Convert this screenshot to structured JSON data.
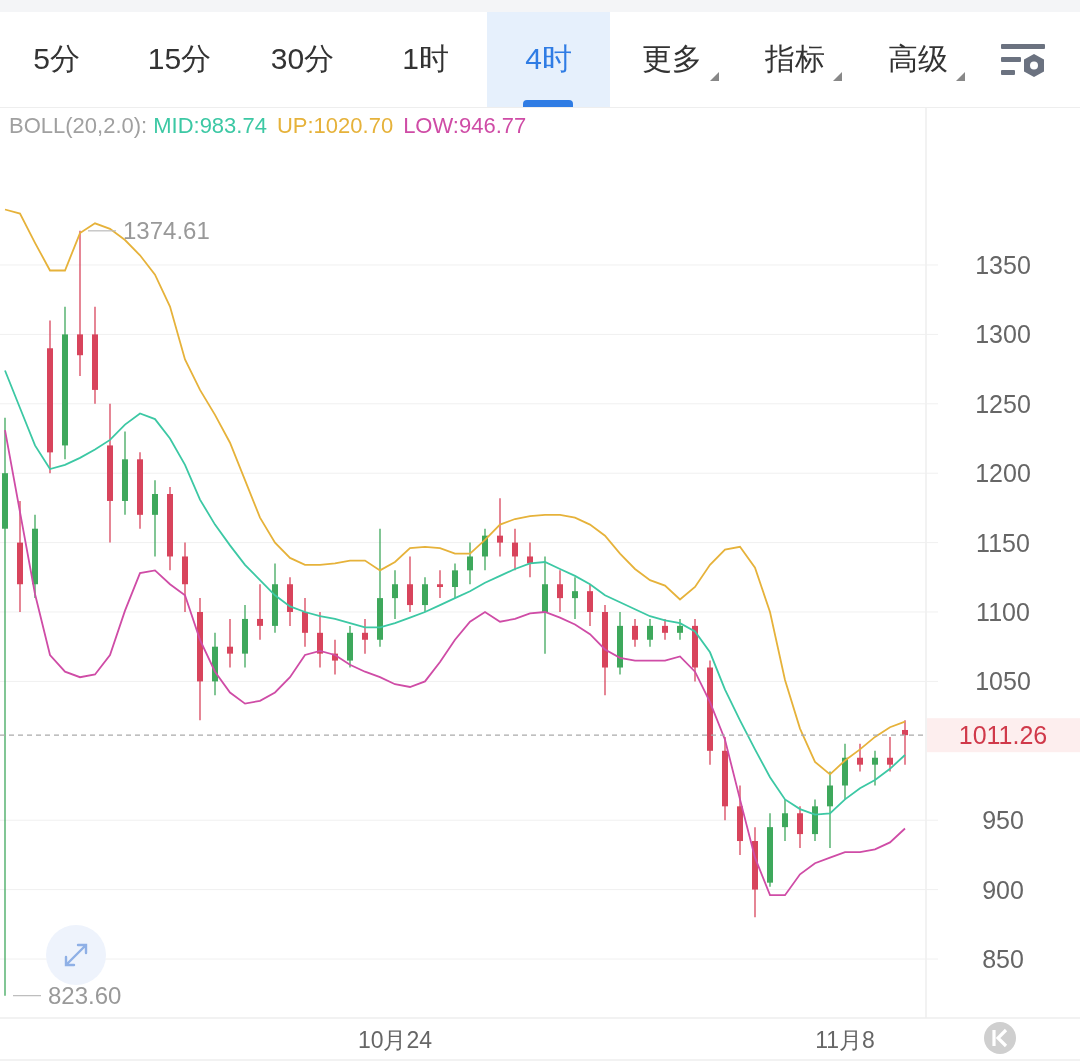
{
  "tabs": [
    {
      "label": "5分",
      "selected": false,
      "kind": "plain"
    },
    {
      "label": "15分",
      "selected": false,
      "kind": "plain"
    },
    {
      "label": "30分",
      "selected": false,
      "kind": "plain"
    },
    {
      "label": "1时",
      "selected": false,
      "kind": "plain"
    },
    {
      "label": "4时",
      "selected": true,
      "kind": "plain"
    },
    {
      "label": "更多",
      "selected": false,
      "kind": "dropdown"
    },
    {
      "label": "指标",
      "selected": false,
      "kind": "dropdown"
    },
    {
      "label": "高级",
      "selected": false,
      "kind": "dropdown"
    }
  ],
  "legend": {
    "label": "BOLL(20,2.0):"
  },
  "chart": {
    "chart_data": {
      "type": "candlestick",
      "categories": [
        null,
        null,
        null,
        null,
        null,
        null,
        null,
        null,
        null,
        null,
        null,
        null,
        null,
        null,
        null,
        null,
        null,
        null,
        null,
        null,
        null,
        null,
        null,
        null,
        null,
        null,
        "10月24",
        null,
        null,
        null,
        null,
        null,
        null,
        null,
        null,
        null,
        null,
        null,
        null,
        null,
        null,
        null,
        null,
        null,
        null,
        null,
        null,
        null,
        null,
        null,
        null,
        null,
        null,
        null,
        null,
        null,
        "11月8",
        null,
        null,
        null,
        null
      ],
      "ohlc": [
        [
          1160,
          1240,
          823.6,
          1200
        ],
        [
          1150,
          1180,
          1100,
          1120
        ],
        [
          1120,
          1170,
          1110,
          1160
        ],
        [
          1290,
          1310,
          1200,
          1215
        ],
        [
          1220,
          1320,
          1210,
          1300
        ],
        [
          1300,
          1374.61,
          1270,
          1285
        ],
        [
          1300,
          1320,
          1250,
          1260
        ],
        [
          1220,
          1250,
          1150,
          1180
        ],
        [
          1180,
          1230,
          1170,
          1210
        ],
        [
          1210,
          1215,
          1160,
          1170
        ],
        [
          1170,
          1195,
          1140,
          1185
        ],
        [
          1185,
          1190,
          1130,
          1140
        ],
        [
          1140,
          1150,
          1100,
          1120
        ],
        [
          1100,
          1110,
          1022,
          1050
        ],
        [
          1050,
          1085,
          1040,
          1075
        ],
        [
          1075,
          1095,
          1060,
          1070
        ],
        [
          1070,
          1105,
          1060,
          1095
        ],
        [
          1095,
          1120,
          1080,
          1090
        ],
        [
          1090,
          1135,
          1085,
          1120
        ],
        [
          1120,
          1125,
          1090,
          1100
        ],
        [
          1100,
          1110,
          1075,
          1085
        ],
        [
          1085,
          1100,
          1060,
          1070
        ],
        [
          1070,
          1080,
          1055,
          1065
        ],
        [
          1065,
          1090,
          1060,
          1085
        ],
        [
          1085,
          1095,
          1070,
          1080
        ],
        [
          1080,
          1160,
          1075,
          1110
        ],
        [
          1110,
          1130,
          1095,
          1120
        ],
        [
          1120,
          1140,
          1100,
          1105
        ],
        [
          1105,
          1125,
          1100,
          1120
        ],
        [
          1120,
          1130,
          1110,
          1118
        ],
        [
          1118,
          1135,
          1110,
          1130
        ],
        [
          1130,
          1150,
          1120,
          1140
        ],
        [
          1140,
          1160,
          1130,
          1155
        ],
        [
          1155,
          1182,
          1140,
          1150
        ],
        [
          1150,
          1160,
          1130,
          1140
        ],
        [
          1140,
          1150,
          1125,
          1135
        ],
        [
          1100,
          1140,
          1070,
          1120
        ],
        [
          1120,
          1130,
          1100,
          1110
        ],
        [
          1110,
          1125,
          1095,
          1115
        ],
        [
          1115,
          1120,
          1090,
          1100
        ],
        [
          1100,
          1105,
          1040,
          1060
        ],
        [
          1060,
          1100,
          1055,
          1090
        ],
        [
          1090,
          1095,
          1075,
          1080
        ],
        [
          1080,
          1095,
          1075,
          1090
        ],
        [
          1090,
          1095,
          1080,
          1085
        ],
        [
          1085,
          1095,
          1080,
          1090
        ],
        [
          1090,
          1095,
          1050,
          1060
        ],
        [
          1060,
          1065,
          990,
          1000
        ],
        [
          1000,
          1010,
          950,
          960
        ],
        [
          960,
          975,
          925,
          935
        ],
        [
          935,
          945,
          880,
          900
        ],
        [
          905,
          955,
          902,
          945
        ],
        [
          945,
          965,
          935,
          955
        ],
        [
          955,
          960,
          930,
          940
        ],
        [
          940,
          965,
          935,
          960
        ],
        [
          960,
          985,
          930,
          975
        ],
        [
          975,
          1005,
          965,
          995
        ],
        [
          995,
          1005,
          985,
          990
        ],
        [
          990,
          1000,
          975,
          995
        ],
        [
          995,
          1010,
          985,
          990
        ],
        [
          1015,
          1022,
          990,
          1011.26
        ]
      ],
      "series": [
        {
          "name": "MID:983.74",
          "type": "line",
          "color": "#3cc8a4",
          "values": [
            1274,
            1247,
            1220,
            1203,
            1206,
            1211,
            1217,
            1224,
            1235,
            1243,
            1239,
            1225,
            1206,
            1181,
            1163,
            1148,
            1134,
            1123,
            1112,
            1104,
            1100,
            1097,
            1095,
            1092,
            1089,
            1089,
            1092,
            1096,
            1100,
            1105,
            1110,
            1115,
            1121,
            1126,
            1131,
            1135,
            1136,
            1131,
            1126,
            1120,
            1112,
            1107,
            1102,
            1097,
            1094,
            1092,
            1086,
            1071,
            1044,
            1022,
            1001,
            981,
            965,
            958,
            954,
            955,
            965,
            973,
            979,
            987,
            997
          ]
        },
        {
          "name": "UP:1020.70",
          "type": "line",
          "color": "#e6b23a",
          "values": [
            1390,
            1387,
            1366,
            1346,
            1346,
            1373,
            1380,
            1376,
            1368,
            1357,
            1343,
            1320,
            1282,
            1260,
            1242,
            1222,
            1195,
            1168,
            1150,
            1139,
            1134,
            1134,
            1135,
            1137,
            1137,
            1130,
            1136,
            1146,
            1147,
            1146,
            1142,
            1142,
            1152,
            1163,
            1167,
            1169,
            1170,
            1170,
            1168,
            1163,
            1155,
            1142,
            1131,
            1123,
            1119,
            1109,
            1118,
            1134,
            1145,
            1147,
            1132,
            1100,
            1051,
            1016,
            992,
            983,
            993,
            1001,
            1010,
            1017,
            1021
          ]
        },
        {
          "name": "LOW:946.77",
          "type": "line",
          "color": "#cf4ca6",
          "values": [
            1231,
            1172,
            1113,
            1069,
            1057,
            1053,
            1055,
            1069,
            1101,
            1128,
            1130,
            1120,
            1112,
            1080,
            1057,
            1042,
            1034,
            1036,
            1042,
            1053,
            1069,
            1072,
            1069,
            1062,
            1057,
            1053,
            1048,
            1046,
            1050,
            1064,
            1080,
            1093,
            1100,
            1093,
            1095,
            1099,
            1100,
            1096,
            1091,
            1084,
            1073,
            1067,
            1065,
            1065,
            1065,
            1068,
            1057,
            1035,
            1008,
            965,
            923,
            896,
            896,
            911,
            919,
            923,
            927,
            927,
            929,
            934,
            944
          ]
        }
      ],
      "ylim": [
        807.5,
        1463.1
      ],
      "yticks": [
        850,
        900,
        950,
        1050,
        1100,
        1150,
        1200,
        1250,
        1300,
        1350
      ],
      "grid": true,
      "annotations": [
        "1374.61",
        "823.60"
      ],
      "ref_lines": [
        {
          "axis": "y",
          "value": 1011.26,
          "label": "1011.26"
        }
      ]
    }
  }
}
